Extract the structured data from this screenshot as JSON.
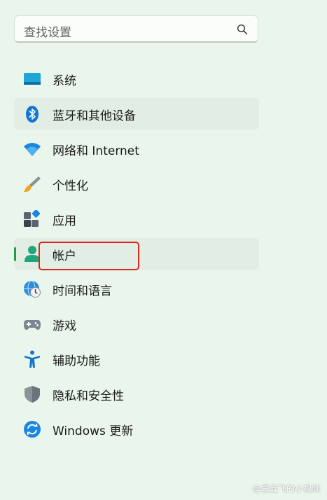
{
  "search": {
    "placeholder": "查找设置",
    "icon": "search-icon"
  },
  "nav": {
    "items": [
      {
        "label": "系统",
        "icon": "system-icon"
      },
      {
        "label": "蓝牙和其他设备",
        "icon": "bluetooth-icon",
        "state": "hover"
      },
      {
        "label": "网络和 Internet",
        "icon": "wifi-icon"
      },
      {
        "label": "个性化",
        "icon": "brush-icon"
      },
      {
        "label": "应用",
        "icon": "apps-icon"
      },
      {
        "label": "帐户",
        "icon": "account-icon",
        "state": "selected"
      },
      {
        "label": "时间和语言",
        "icon": "time-language-icon"
      },
      {
        "label": "游戏",
        "icon": "gamepad-icon"
      },
      {
        "label": "辅助功能",
        "icon": "accessibility-icon"
      },
      {
        "label": "隐私和安全性",
        "icon": "shield-icon"
      },
      {
        "label": "Windows 更新",
        "icon": "update-icon"
      }
    ]
  },
  "colors": {
    "background": "#eaf5ec",
    "selected_indicator": "#1d9c4b",
    "highlight_box": "#e2261c"
  },
  "watermark": "@嘉鑫飞的小视频"
}
